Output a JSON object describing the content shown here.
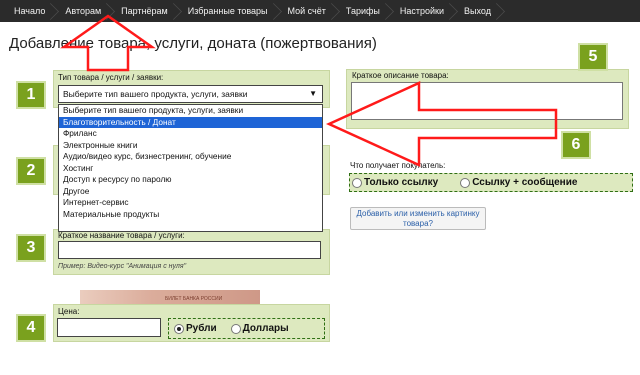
{
  "nav": {
    "items": [
      "Начало",
      "Авторам",
      "Партнёрам",
      "Избранные товары",
      "Мой счёт",
      "Тарифы",
      "Настройки",
      "Выход"
    ]
  },
  "page_title": "Добавление товара, услуги, доната (пожертвования)",
  "form": {
    "type_label": "Тип товара / услуги / заявки:",
    "type_selected": "Выберите тип вашего продукта, услуги, заявки",
    "type_options": [
      "Выберите тип вашего продукта, услуги, заявки",
      "Благотворительность / Донат",
      "Фриланс",
      "Электронные книги",
      "Аудио/видео курс, бизнестренинг, обучение",
      "Хостинг",
      "Доступ к ресурсу по паролю",
      "Другое",
      "Интернет-сервис",
      "Материальные продукты"
    ],
    "highlighted_option_index": 1,
    "name_label": "Краткое название товара / услуги:",
    "name_hint": "Пример: Видео-курс \"Анимация с нуля\"",
    "price_label": "Цена:",
    "currency_rub": "Рубли",
    "currency_usd": "Доллары",
    "currency_selected": "Рубли",
    "description_label": "Краткое описание товара:",
    "buyer_gets_label": "Что получает покупатель:",
    "buyer_option_link": "Только ссылку",
    "buyer_option_link_msg": "Ссылку + сообщение",
    "image_button": "Добавить или изменить картинку товара?",
    "banknote_text": "БИЛЕТ БАНКА РОССИИ"
  },
  "callouts": [
    "1",
    "2",
    "3",
    "4",
    "5",
    "6"
  ],
  "colors": {
    "nav_bg": "#2b2b2b",
    "panel_bg": "#dde9bf",
    "callout_bg": "#7aa11e",
    "highlight": "#1e64d6",
    "arrow_red": "#ff1a1a"
  }
}
